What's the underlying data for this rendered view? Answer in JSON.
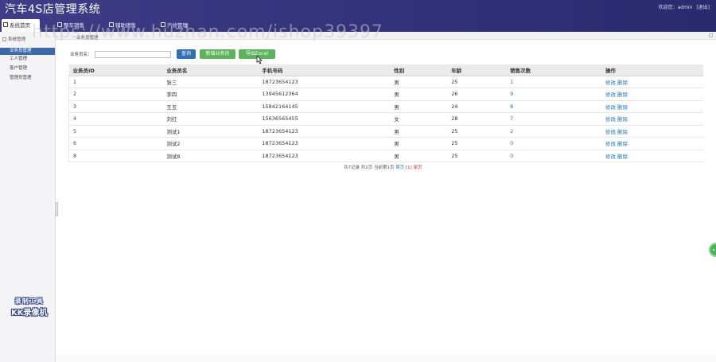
{
  "header": {
    "app_title": "汽车4S店管理系统",
    "welcome_text": "欢迎您：admin",
    "logout": "[退出]",
    "colors": {
      "header_bg": "#3f3d86",
      "accent_blue": "#2f6fb3",
      "accent_green": "#5db35b",
      "sidebar_active": "#3c6aa8"
    }
  },
  "topnav": {
    "tabs": [
      {
        "label": "系统首页",
        "icon": "home-icon"
      },
      {
        "label": "整车销售",
        "icon": "doc-icon"
      },
      {
        "label": "辅助销售",
        "icon": "edit-icon"
      },
      {
        "label": "汽修管理",
        "icon": "doc-icon"
      }
    ]
  },
  "watermark": "https://www.huzhan.com/ishop39397",
  "breadcrumb": "业务员管理",
  "sidebar": {
    "heading": "系统管理",
    "items": [
      {
        "label": "业务员管理",
        "active": true
      },
      {
        "label": "工人管理",
        "active": false
      },
      {
        "label": "客户管理",
        "active": false
      },
      {
        "label": "管理员管理",
        "active": false
      }
    ],
    "recorder": {
      "line1": "录制工具",
      "line2": "KK录像机"
    }
  },
  "search": {
    "label": "业务员名：",
    "value": "",
    "query_button": "查询",
    "add_button": "新增业务员",
    "export_button": "导出Excel"
  },
  "table": {
    "headers": [
      "业务员ID",
      "业务员名",
      "手机号码",
      "性别",
      "年龄",
      "销售次数",
      "操作"
    ],
    "rows": [
      {
        "id": "1",
        "name": "张三",
        "phone": "18723654123",
        "sex": "男",
        "age": "25",
        "sales": "1",
        "edit": "修改",
        "delete": "删除"
      },
      {
        "id": "2",
        "name": "李四",
        "phone": "13945612364",
        "sex": "男",
        "age": "26",
        "sales": "9",
        "edit": "修改",
        "delete": "删除"
      },
      {
        "id": "3",
        "name": "王五",
        "phone": "15842164145",
        "sex": "男",
        "age": "24",
        "sales": "8",
        "edit": "修改",
        "delete": "删除"
      },
      {
        "id": "4",
        "name": "刘红",
        "phone": "15636565455",
        "sex": "女",
        "age": "28",
        "sales": "7",
        "edit": "修改",
        "delete": "删除"
      },
      {
        "id": "5",
        "name": "测试1",
        "phone": "18723654123",
        "sex": "男",
        "age": "25",
        "sales": "2",
        "edit": "修改",
        "delete": "删除"
      },
      {
        "id": "6",
        "name": "测试2",
        "phone": "18723654123",
        "sex": "男",
        "age": "25",
        "sales": "0",
        "edit": "修改",
        "delete": "删除"
      },
      {
        "id": "8",
        "name": "测试8",
        "phone": "18723654123",
        "sex": "男",
        "age": "25",
        "sales": "0",
        "edit": "修改",
        "delete": "删除"
      }
    ]
  },
  "pagination": {
    "summary": "共7记录 共1页 当前第1页",
    "first": "首页",
    "current": "[1]",
    "last": "尾页"
  }
}
